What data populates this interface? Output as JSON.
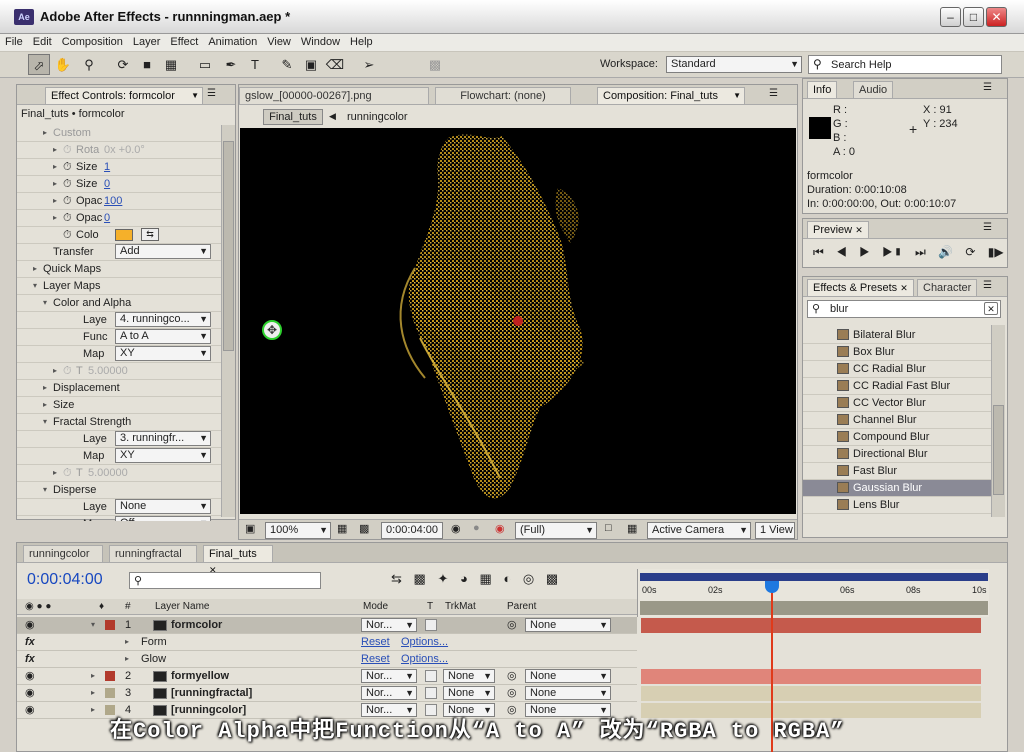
{
  "window": {
    "title": "Adobe After Effects - runnningman.aep *",
    "logo": "Ae"
  },
  "menu": [
    "File",
    "Edit",
    "Composition",
    "Layer",
    "Effect",
    "Animation",
    "View",
    "Window",
    "Help"
  ],
  "toolbar": {
    "workspace_label": "Workspace:",
    "workspace_value": "Standard",
    "search_placeholder": "Search Help"
  },
  "effect_controls": {
    "tab": "Effect Controls: formcolor",
    "breadcrumb": "Final_tuts • formcolor",
    "rows": [
      {
        "label": "Custom",
        "value": "",
        "ind": 3,
        "gray": true,
        "tri": "▸"
      },
      {
        "label": "Rota",
        "value": "0x +0.0°",
        "ind": 4,
        "gray": true,
        "tri": "▸",
        "sw": true
      },
      {
        "label": "Size",
        "value": "1",
        "ind": 4,
        "tri": "▸",
        "sw": true,
        "link": true
      },
      {
        "label": "Size",
        "value": "0",
        "ind": 4,
        "tri": "▸",
        "sw": true,
        "link": true
      },
      {
        "label": "Opac",
        "value": "100",
        "ind": 4,
        "tri": "▸",
        "sw": true,
        "link": true
      },
      {
        "label": "Opac",
        "value": "0",
        "ind": 4,
        "tri": "▸",
        "sw": true,
        "link": true
      },
      {
        "label": "Colo",
        "value": "",
        "ind": 4,
        "sw": true,
        "color": true
      },
      {
        "label": "Transfer",
        "value": "Add",
        "ind": 3,
        "dd": true
      },
      {
        "label": "Quick Maps",
        "value": "",
        "ind": 2,
        "tri": "▸"
      },
      {
        "label": "Layer Maps",
        "value": "",
        "ind": 2,
        "tri": "▾"
      },
      {
        "label": "Color and Alpha",
        "value": "",
        "ind": 3,
        "tri": "▾"
      },
      {
        "label": "Laye",
        "value": "4. runningco...",
        "ind": 4,
        "dd": true
      },
      {
        "label": "Func",
        "value": "A to A",
        "ind": 4,
        "dd": true
      },
      {
        "label": "Map",
        "value": "XY",
        "ind": 4,
        "dd": true
      },
      {
        "label": "T",
        "value": "5.00000",
        "ind": 4,
        "gray": true,
        "tri": "▸",
        "sw": true
      },
      {
        "label": "Displacement",
        "value": "",
        "ind": 3,
        "tri": "▸"
      },
      {
        "label": "Size",
        "value": "",
        "ind": 3,
        "tri": "▸"
      },
      {
        "label": "Fractal Strength",
        "value": "",
        "ind": 3,
        "tri": "▾"
      },
      {
        "label": "Laye",
        "value": "3. runningfr...",
        "ind": 4,
        "dd": true
      },
      {
        "label": "Map",
        "value": "XY",
        "ind": 4,
        "dd": true
      },
      {
        "label": "T",
        "value": "5.00000",
        "ind": 4,
        "gray": true,
        "tri": "▸",
        "sw": true
      },
      {
        "label": "Disperse",
        "value": "",
        "ind": 3,
        "tri": "▾"
      },
      {
        "label": "Laye",
        "value": "None",
        "ind": 4,
        "dd": true
      },
      {
        "label": "Map",
        "value": "Off",
        "ind": 4,
        "dd": true
      }
    ]
  },
  "composition": {
    "tabs": [
      "gslow_[00000-00267].png",
      "Flowchart: (none)",
      "Composition: Final_tuts"
    ],
    "breadcrumb_active": "Final_tuts",
    "breadcrumb_next": "runningcolor",
    "zoom": "100%",
    "timecode": "0:00:04:00",
    "resolution": "(Full)",
    "camera": "Active Camera",
    "view": "1 View"
  },
  "info": {
    "tabs": [
      "Info",
      "Audio"
    ],
    "r": "R :",
    "g": "G :",
    "b": "B :",
    "a": "A : 0",
    "x": "X : 91",
    "y": "Y : 234",
    "layer": "formcolor",
    "duration": "Duration: 0:00:10:08",
    "inout": "In: 0:00:00:00, Out: 0:00:10:07"
  },
  "preview": {
    "tab": "Preview"
  },
  "effects_presets": {
    "tabs": [
      "Effects & Presets",
      "Character"
    ],
    "search_value": "blur",
    "items": [
      "Bilateral Blur",
      "Box Blur",
      "CC Radial Blur",
      "CC Radial Fast Blur",
      "CC Vector Blur",
      "Channel Blur",
      "Compound Blur",
      "Directional Blur",
      "Fast Blur",
      "Gaussian Blur",
      "Lens Blur"
    ],
    "selected": "Gaussian Blur"
  },
  "timeline": {
    "tabs": [
      "runningcolor",
      "runningfractal",
      "Final_tuts"
    ],
    "timecode": "0:00:04:00",
    "cols": {
      "name": "Layer Name",
      "mode": "Mode",
      "t": "T",
      "trkmat": "TrkMat",
      "parent": "Parent"
    },
    "ruler": [
      "00s",
      "02s",
      "",
      "06s",
      "08s",
      "10s"
    ],
    "layers": [
      {
        "num": "1",
        "name": "formcolor",
        "mode": "Nor...",
        "trk": "",
        "parent": "None",
        "swatch": "#b23a2c",
        "sel": true
      },
      {
        "num": "",
        "name": "Form",
        "mode": "Reset",
        "trk": "Options...",
        "parent": "",
        "fx": true
      },
      {
        "num": "",
        "name": "Glow",
        "mode": "Reset",
        "trk": "Options...",
        "parent": "",
        "fx": true
      },
      {
        "num": "2",
        "name": "formyellow",
        "mode": "Nor...",
        "trk": "None",
        "parent": "None",
        "swatch": "#b23a2c"
      },
      {
        "num": "3",
        "name": "[runningfractal]",
        "mode": "Nor...",
        "trk": "None",
        "parent": "None",
        "swatch": "#b0a88a"
      },
      {
        "num": "4",
        "name": "[runningcolor]",
        "mode": "Nor...",
        "trk": "None",
        "parent": "None",
        "swatch": "#b0a88a"
      }
    ]
  },
  "subtitle": "在Color Alpha中把Function从“A to A” 改为“RGBA to RGBA”",
  "colors": {
    "accent": "#f5b02a",
    "playhead": "#e03a1a",
    "layer_red": "#e0857a",
    "layer_tan": "#d7cfb3"
  }
}
